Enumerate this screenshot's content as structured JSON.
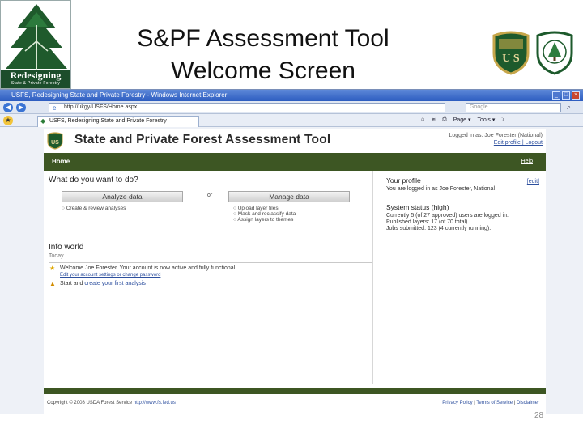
{
  "slide": {
    "logo_title": "Redesigning",
    "logo_subtitle": "State & Private Forestry",
    "title_line1": "S&PF Assessment Tool",
    "title_line2": "Welcome Screen",
    "usfs_shield_text": "U S",
    "page_number": "28"
  },
  "browser": {
    "window_title": "USFS, Redesigning State and Private Forestry - Windows Internet Explorer",
    "url": "http://ukgy/USFS/Home.aspx",
    "search_placeholder": "Google",
    "tab_label": "USFS, Redesigning State and Private Forestry",
    "tools": [
      "Page ▾",
      "Tools ▾"
    ]
  },
  "app": {
    "title": "State and Private Forest Assessment Tool",
    "user_line": "Logged in as: Joe Forester (National)",
    "user_links": "Edit profile | Logout",
    "home_label": "Home",
    "help_label": "Help",
    "question": "What do you want to do?",
    "analyze_button": "Analyze data",
    "or_text": "or",
    "manage_button": "Manage data",
    "analyze_bullets": [
      "Create & review analyses"
    ],
    "manage_bullets": [
      "Upload layer files",
      "Mask and reclassify data",
      "Assign layers to themes"
    ],
    "info_world_heading": "Info world",
    "today_label": "Today",
    "messages": [
      {
        "text": "Welcome Joe Forester. Your account is now active and fully functional.",
        "sub": "Edit your account settings or change password"
      },
      {
        "text_prefix": "Start and ",
        "link": "create your first analysis"
      }
    ],
    "profile_heading": "Your profile",
    "profile_edit": "[edit]",
    "profile_text": "You are logged in as Joe Forester, National",
    "system_heading": "System status (high)",
    "system_lines": [
      "Currently 5 (of 27 approved) users are logged in.",
      "Published layers: 17 (of 70 total).",
      "Jobs submitted: 123 (4 currently running)."
    ],
    "footer_left_text": "Copyright © 2008 USDA Forest Service ",
    "footer_left_link": "http://www.fs.fed.us",
    "footer_right": [
      "Privacy Policy",
      "Terms of Service",
      "Disclaimer"
    ]
  }
}
